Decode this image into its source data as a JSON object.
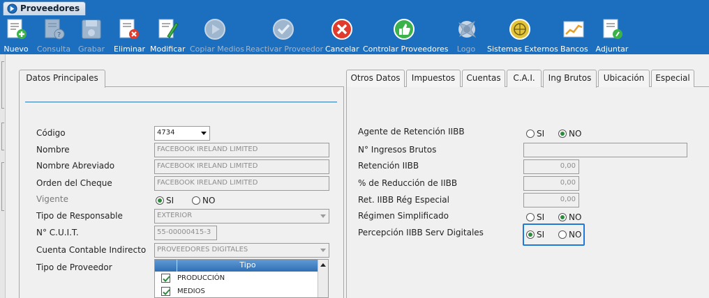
{
  "window": {
    "title": "Proveedores"
  },
  "toolbar": {
    "buttons": [
      {
        "label": "Nuevo",
        "enabled": true
      },
      {
        "label": "Consulta",
        "enabled": false
      },
      {
        "label": "Grabar",
        "enabled": false
      },
      {
        "label": "Eliminar",
        "enabled": true
      },
      {
        "label": "Modificar",
        "enabled": true
      },
      {
        "label": "Copiar Medios",
        "enabled": false
      },
      {
        "label": "Reactivar Proveedor",
        "enabled": false
      },
      {
        "label": "Cancelar",
        "enabled": true
      },
      {
        "label": "Controlar Proveedores",
        "enabled": true
      },
      {
        "label": "Logo",
        "enabled": false
      },
      {
        "label": "Sistemas Externos",
        "enabled": true
      },
      {
        "label": "Bancos",
        "enabled": true
      },
      {
        "label": "Adjuntar",
        "enabled": true
      }
    ]
  },
  "left_panel": {
    "tab": "Datos Principales",
    "codigo": {
      "label": "Código",
      "value": "4734"
    },
    "nombre": {
      "label": "Nombre",
      "value": "FACEBOOK IRELAND LIMITED"
    },
    "nombre_abreviado": {
      "label": "Nombre Abreviado",
      "value": "FACEBOOK IRELAND LIMITED"
    },
    "orden_cheque": {
      "label": "Orden del Cheque",
      "value": "FACEBOOK IRELAND LIMITED"
    },
    "vigente": {
      "label": "Vigente",
      "si": "SI",
      "no": "NO",
      "selected": "SI"
    },
    "tipo_responsable": {
      "label": "Tipo de Responsable",
      "value": "EXTERIOR"
    },
    "cuit": {
      "label": "N° C.U.I.T.",
      "value": "55-00000415-3"
    },
    "cuenta_contable": {
      "label": "Cuenta Contable Indirecto",
      "value": "PROVEEDORES DIGITALES"
    },
    "tipo_proveedor": {
      "label": "Tipo de Proveedor",
      "column": "Tipo",
      "rows": [
        {
          "value": "PRODUCCIÓN",
          "checked": true
        },
        {
          "value": "MEDIOS",
          "checked": true
        }
      ]
    }
  },
  "right_panel": {
    "tabs": [
      "Otros Datos",
      "Impuestos",
      "Cuentas",
      "C.A.I.",
      "Ing Brutos",
      "Ubicación",
      "Especial"
    ],
    "active_tab": "Ing Brutos",
    "agente_retencion": {
      "label": "Agente de Retención IIBB",
      "si": "SI",
      "no": "NO",
      "selected": "NO"
    },
    "nro_ingresos_brutos": {
      "label": "N° Ingresos Brutos",
      "value": ""
    },
    "retencion_iibb": {
      "label": "Retención IIBB",
      "value": "0,00"
    },
    "reduccion_iibb": {
      "label": "% de Reducción de IIBB",
      "value": "0,00"
    },
    "ret_reg_especial": {
      "label": "Ret. IIBB Rég Especial",
      "value": "0,00"
    },
    "regimen_simplificado": {
      "label": "Régimen Simplificado",
      "si": "SI",
      "no": "NO",
      "selected": "NO"
    },
    "percepcion_digitales": {
      "label": "Percepción IIBB Serv Digitales",
      "si": "SI",
      "no": "NO",
      "selected": "SI"
    }
  },
  "colors": {
    "toolbar": "#1c6fbe",
    "focus_border": "#1e7ad8",
    "radio_on": "#2e8b3c"
  }
}
